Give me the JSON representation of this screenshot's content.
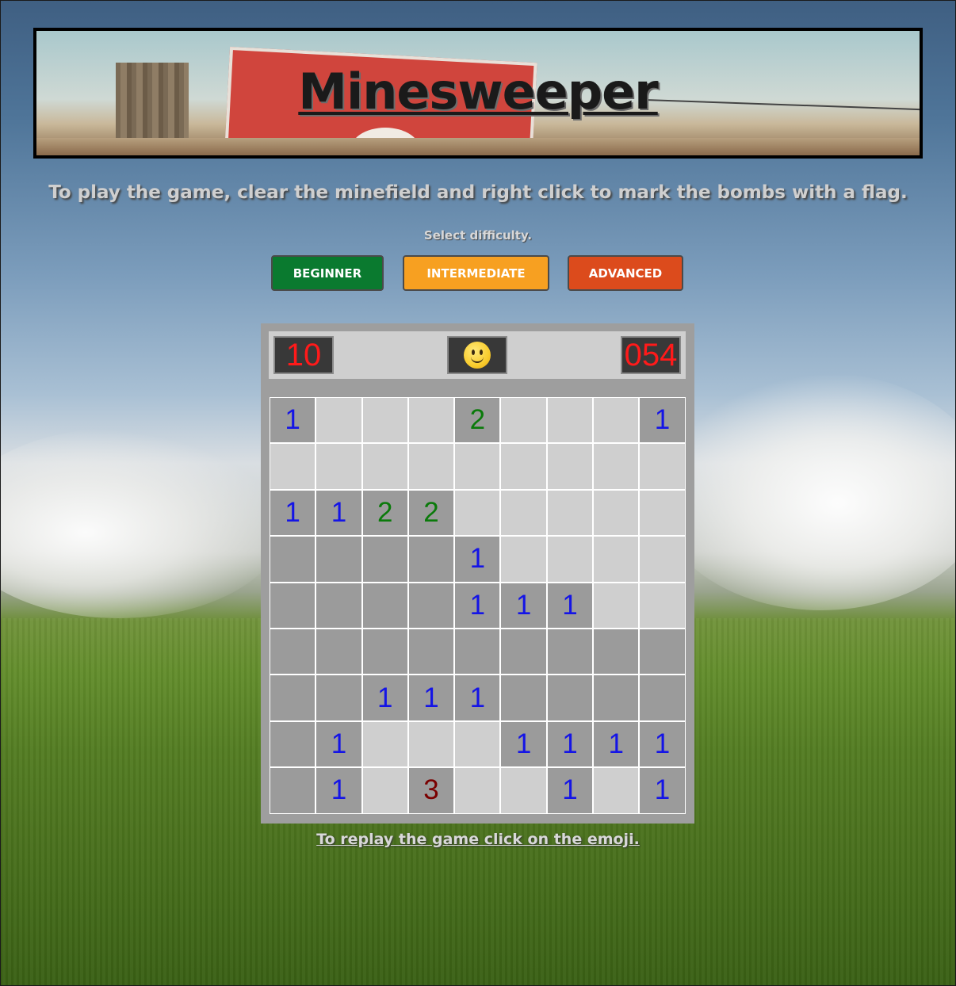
{
  "banner": {
    "title": "Minesweeper"
  },
  "instructions": "To play the game, clear the minefield and right click to mark the bombs with a flag.",
  "difficulty": {
    "label": "Select difficulty.",
    "buttons": [
      {
        "label": "BEGINNER",
        "color": "#0a7a2f"
      },
      {
        "label": "INTERMEDIATE",
        "color": "#f7a021"
      },
      {
        "label": "ADVANCED",
        "color": "#dc4b1c"
      }
    ]
  },
  "status": {
    "mines_remaining": "10",
    "timer": "054",
    "face_icon": "smiley-face-icon"
  },
  "number_colors": {
    "1": "#1414e6",
    "2": "#0a7a0a",
    "3": "#7a0000"
  },
  "board": {
    "rows": 9,
    "cols": 9,
    "cells": [
      [
        {
          "s": "h",
          "v": "1"
        },
        {
          "s": "r",
          "v": ""
        },
        {
          "s": "r",
          "v": ""
        },
        {
          "s": "r",
          "v": ""
        },
        {
          "s": "h",
          "v": "2"
        },
        {
          "s": "r",
          "v": ""
        },
        {
          "s": "r",
          "v": ""
        },
        {
          "s": "r",
          "v": ""
        },
        {
          "s": "h",
          "v": "1"
        }
      ],
      [
        {
          "s": "r",
          "v": ""
        },
        {
          "s": "r",
          "v": ""
        },
        {
          "s": "r",
          "v": ""
        },
        {
          "s": "r",
          "v": ""
        },
        {
          "s": "r",
          "v": ""
        },
        {
          "s": "r",
          "v": ""
        },
        {
          "s": "r",
          "v": ""
        },
        {
          "s": "r",
          "v": ""
        },
        {
          "s": "r",
          "v": ""
        }
      ],
      [
        {
          "s": "h",
          "v": "1"
        },
        {
          "s": "h",
          "v": "1"
        },
        {
          "s": "h",
          "v": "2"
        },
        {
          "s": "h",
          "v": "2"
        },
        {
          "s": "r",
          "v": ""
        },
        {
          "s": "r",
          "v": ""
        },
        {
          "s": "r",
          "v": ""
        },
        {
          "s": "r",
          "v": ""
        },
        {
          "s": "r",
          "v": ""
        }
      ],
      [
        {
          "s": "h",
          "v": ""
        },
        {
          "s": "h",
          "v": ""
        },
        {
          "s": "h",
          "v": ""
        },
        {
          "s": "h",
          "v": ""
        },
        {
          "s": "h",
          "v": "1"
        },
        {
          "s": "r",
          "v": ""
        },
        {
          "s": "r",
          "v": ""
        },
        {
          "s": "r",
          "v": ""
        },
        {
          "s": "r",
          "v": ""
        }
      ],
      [
        {
          "s": "h",
          "v": ""
        },
        {
          "s": "h",
          "v": ""
        },
        {
          "s": "h",
          "v": ""
        },
        {
          "s": "h",
          "v": ""
        },
        {
          "s": "h",
          "v": "1"
        },
        {
          "s": "h",
          "v": "1"
        },
        {
          "s": "h",
          "v": "1"
        },
        {
          "s": "r",
          "v": ""
        },
        {
          "s": "r",
          "v": ""
        }
      ],
      [
        {
          "s": "h",
          "v": ""
        },
        {
          "s": "h",
          "v": ""
        },
        {
          "s": "h",
          "v": ""
        },
        {
          "s": "h",
          "v": ""
        },
        {
          "s": "h",
          "v": ""
        },
        {
          "s": "h",
          "v": ""
        },
        {
          "s": "h",
          "v": ""
        },
        {
          "s": "h",
          "v": ""
        },
        {
          "s": "h",
          "v": ""
        }
      ],
      [
        {
          "s": "h",
          "v": ""
        },
        {
          "s": "h",
          "v": ""
        },
        {
          "s": "h",
          "v": "1"
        },
        {
          "s": "h",
          "v": "1"
        },
        {
          "s": "h",
          "v": "1"
        },
        {
          "s": "h",
          "v": ""
        },
        {
          "s": "h",
          "v": ""
        },
        {
          "s": "h",
          "v": ""
        },
        {
          "s": "h",
          "v": ""
        }
      ],
      [
        {
          "s": "h",
          "v": ""
        },
        {
          "s": "h",
          "v": "1"
        },
        {
          "s": "r",
          "v": ""
        },
        {
          "s": "r",
          "v": ""
        },
        {
          "s": "r",
          "v": ""
        },
        {
          "s": "h",
          "v": "1"
        },
        {
          "s": "h",
          "v": "1"
        },
        {
          "s": "h",
          "v": "1"
        },
        {
          "s": "h",
          "v": "1"
        }
      ],
      [
        {
          "s": "h",
          "v": ""
        },
        {
          "s": "h",
          "v": "1"
        },
        {
          "s": "r",
          "v": ""
        },
        {
          "s": "h",
          "v": "3"
        },
        {
          "s": "r",
          "v": ""
        },
        {
          "s": "r",
          "v": ""
        },
        {
          "s": "h",
          "v": "1"
        },
        {
          "s": "r",
          "v": ""
        },
        {
          "s": "h",
          "v": "1"
        }
      ]
    ]
  },
  "replay_text": "To replay the game click on the emoji."
}
